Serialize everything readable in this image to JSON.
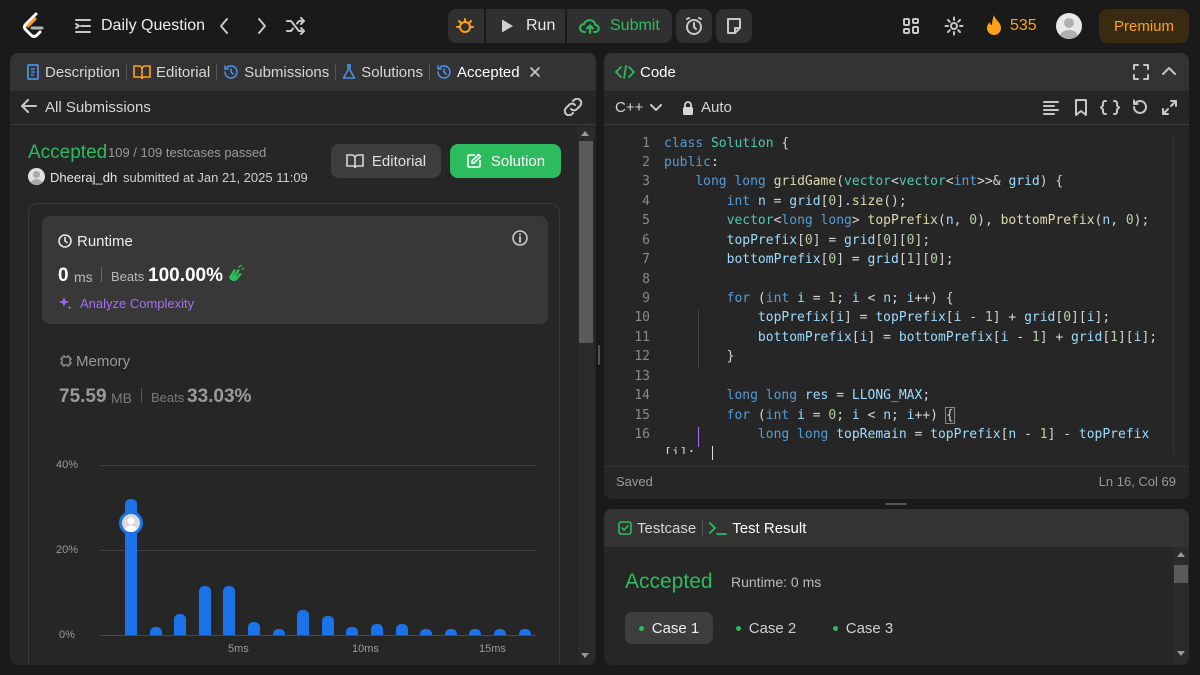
{
  "topbar": {
    "daily_question": "Daily Question",
    "run_label": "Run",
    "submit_label": "Submit",
    "streak_count": "535",
    "premium_label": "Premium"
  },
  "left_tabs": [
    {
      "label": "Description"
    },
    {
      "label": "Editorial"
    },
    {
      "label": "Submissions"
    },
    {
      "label": "Solutions"
    },
    {
      "label": "Accepted"
    }
  ],
  "submission": {
    "back_label": "All Submissions",
    "status": "Accepted",
    "testcases": "109 / 109 testcases passed",
    "username": "Dheeraj_dh",
    "submitted_text": "submitted at Jan 21, 2025 11:09",
    "editorial_button": "Editorial",
    "solution_button": "Solution"
  },
  "runtime": {
    "title": "Runtime",
    "value": "0",
    "unit": "ms",
    "beats_label": "Beats",
    "beats_value": "100.00%",
    "analyze_label": "Analyze Complexity"
  },
  "memory": {
    "title": "Memory",
    "value": "75.59",
    "unit": "MB",
    "beats_label": "Beats",
    "beats_value": "33.03%"
  },
  "chart_data": {
    "type": "bar",
    "y_ticks": [
      "40%",
      "20%",
      "0%"
    ],
    "x_ticks": [
      "5ms",
      "10ms",
      "15ms"
    ],
    "values": [
      32,
      2,
      5,
      11.5,
      11.5,
      3,
      1.5,
      6,
      4.5,
      2,
      2.5,
      2.5,
      1.5,
      1.5,
      1.5,
      1.5,
      1.5
    ],
    "ylim": [
      0,
      40
    ],
    "highlight_index": 0,
    "bar_color": "#1a73e8"
  },
  "editor": {
    "title": "Code",
    "language": "C++",
    "mode": "Auto",
    "status": "Saved",
    "cursor": "Ln 16, Col 69",
    "lines": [
      "1",
      "2",
      "3",
      "4",
      "5",
      "6",
      "7",
      "8",
      "9",
      "10",
      "11",
      "12",
      "13",
      "14",
      "15",
      "16"
    ],
    "wrap_fragment": "[i];"
  },
  "result": {
    "testcase_tab": "Testcase",
    "result_tab": "Test Result",
    "status": "Accepted",
    "runtime": "Runtime: 0 ms",
    "cases": [
      "Case 1",
      "Case 2",
      "Case 3"
    ]
  },
  "colors": {
    "accent_green": "#2cbb5d",
    "streak_orange": "#ffa116",
    "bar_blue": "#1a73e8",
    "analyze_purple": "#a66ef5"
  }
}
